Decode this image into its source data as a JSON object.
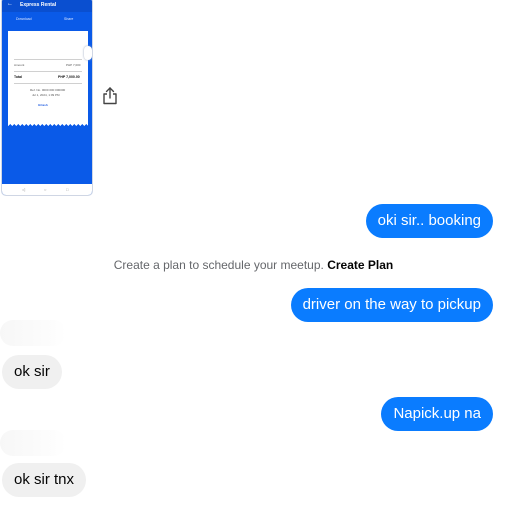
{
  "conversation": {
    "shared_image": {
      "title": "Express Rental",
      "download_label": "Download",
      "share_label": "Share",
      "receipt": {
        "row1_left": "Amount",
        "row1_right": "PHP 7,000",
        "total_label": "Total",
        "total_value": "PHP 7,000.00",
        "ref_line": "Ref. No. 0000 000 000000",
        "date_line": "Jul 1, 2024, 1:09 PM",
        "brand": "GCash"
      }
    },
    "share_icon": "share-icon",
    "messages": [
      {
        "sender": "me",
        "text": "oki sir.. booking"
      },
      {
        "sender": "me",
        "text": "driver on the way to pickup"
      },
      {
        "sender": "me",
        "text": "Napick.up na"
      },
      {
        "sender": "them",
        "text": "ok sir"
      },
      {
        "sender": "them",
        "text": "ok sir tnx"
      }
    ],
    "system_notice": {
      "text": "Create a plan to schedule your meetup.",
      "action": "Create Plan"
    }
  },
  "colors": {
    "outgoing_bubble": "#0a7cff",
    "incoming_bubble": "#f0f0f0",
    "image_blue": "#0a5ae8"
  }
}
